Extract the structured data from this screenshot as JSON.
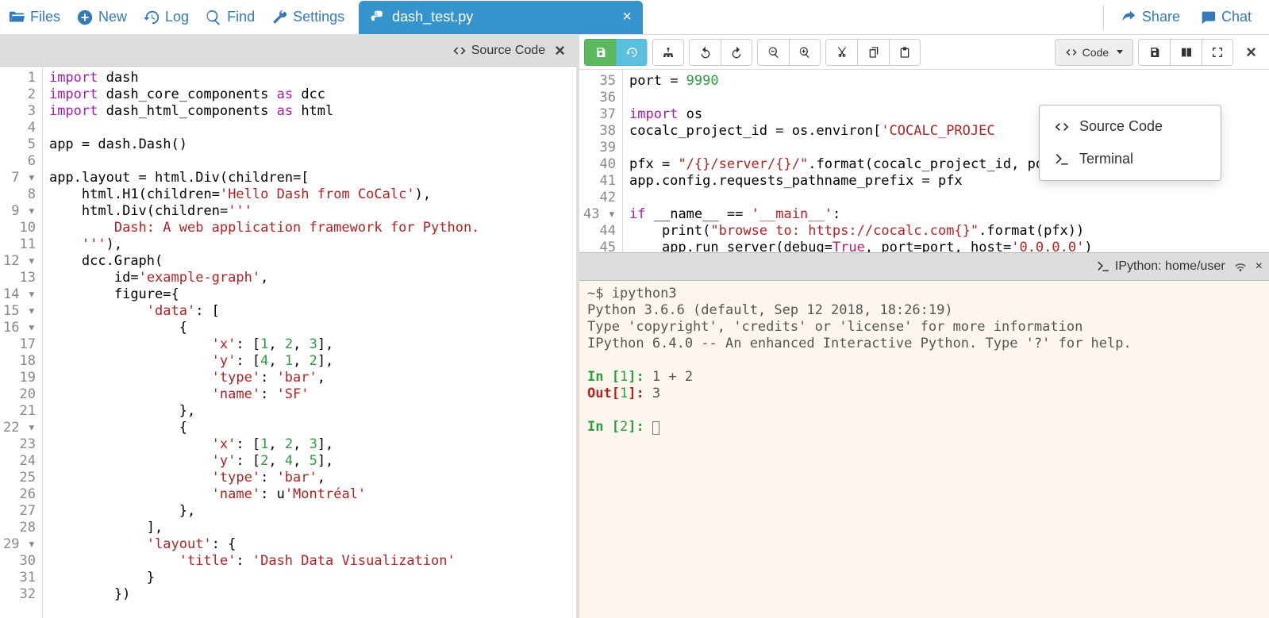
{
  "toolbar": {
    "files": "Files",
    "new": "New",
    "log": "Log",
    "find": "Find",
    "settings": "Settings",
    "share": "Share",
    "chat": "Chat"
  },
  "tab": {
    "filename": "dash_test.py"
  },
  "left_pane": {
    "title": "Source Code",
    "gutter": [
      "1",
      "2",
      "3",
      "4",
      "5",
      "6",
      "7 ▾",
      "8",
      "9 ▾",
      "10",
      "11",
      "12 ▾",
      "13",
      "14 ▾",
      "15 ▾",
      "16 ▾",
      "17",
      "18",
      "19",
      "20",
      "21",
      "22 ▾",
      "23",
      "24",
      "25",
      "26",
      "27",
      "28",
      "29 ▾",
      "30",
      "31",
      "32"
    ],
    "code_lines": [
      [
        [
          "kw",
          "import"
        ],
        [
          "pu",
          " "
        ],
        [
          "id",
          "dash"
        ]
      ],
      [
        [
          "kw",
          "import"
        ],
        [
          "pu",
          " "
        ],
        [
          "id",
          "dash_core_components"
        ],
        [
          "pu",
          " "
        ],
        [
          "kw",
          "as"
        ],
        [
          "pu",
          " "
        ],
        [
          "id",
          "dcc"
        ]
      ],
      [
        [
          "kw",
          "import"
        ],
        [
          "pu",
          " "
        ],
        [
          "id",
          "dash_html_components"
        ],
        [
          "pu",
          " "
        ],
        [
          "kw",
          "as"
        ],
        [
          "pu",
          " "
        ],
        [
          "id",
          "html"
        ]
      ],
      [],
      [
        [
          "id",
          "app "
        ],
        [
          "pu",
          "= "
        ],
        [
          "id",
          "dash.Dash()"
        ]
      ],
      [],
      [
        [
          "id",
          "app.layout "
        ],
        [
          "pu",
          "= "
        ],
        [
          "id",
          "html.Div"
        ],
        [
          "pu",
          "("
        ],
        [
          "id",
          "children"
        ],
        [
          "pu",
          "=["
        ]
      ],
      [
        [
          "pu",
          "    "
        ],
        [
          "id",
          "html.H1"
        ],
        [
          "pu",
          "("
        ],
        [
          "id",
          "children"
        ],
        [
          "pu",
          "="
        ],
        [
          "str",
          "'Hello Dash from CoCalc'"
        ],
        [
          "pu",
          "),"
        ]
      ],
      [
        [
          "pu",
          "    "
        ],
        [
          "id",
          "html.Div"
        ],
        [
          "pu",
          "("
        ],
        [
          "id",
          "children"
        ],
        [
          "pu",
          "="
        ],
        [
          "str",
          "'''"
        ]
      ],
      [
        [
          "pu",
          "        "
        ],
        [
          "str",
          "Dash: A web application framework for Python."
        ]
      ],
      [
        [
          "pu",
          "    "
        ],
        [
          "str",
          "'''"
        ],
        [
          "pu",
          "),"
        ]
      ],
      [
        [
          "pu",
          "    "
        ],
        [
          "id",
          "dcc.Graph"
        ],
        [
          "pu",
          "("
        ]
      ],
      [
        [
          "pu",
          "        "
        ],
        [
          "id",
          "id"
        ],
        [
          "pu",
          "="
        ],
        [
          "str",
          "'example-graph'"
        ],
        [
          "pu",
          ","
        ]
      ],
      [
        [
          "pu",
          "        "
        ],
        [
          "id",
          "figure"
        ],
        [
          "pu",
          "={"
        ]
      ],
      [
        [
          "pu",
          "            "
        ],
        [
          "str",
          "'data'"
        ],
        [
          "pu",
          ": ["
        ]
      ],
      [
        [
          "pu",
          "                {"
        ]
      ],
      [
        [
          "pu",
          "                    "
        ],
        [
          "str",
          "'x'"
        ],
        [
          "pu",
          ": ["
        ],
        [
          "num",
          "1"
        ],
        [
          "pu",
          ", "
        ],
        [
          "num",
          "2"
        ],
        [
          "pu",
          ", "
        ],
        [
          "num",
          "3"
        ],
        [
          "pu",
          "],"
        ]
      ],
      [
        [
          "pu",
          "                    "
        ],
        [
          "str",
          "'y'"
        ],
        [
          "pu",
          ": ["
        ],
        [
          "num",
          "4"
        ],
        [
          "pu",
          ", "
        ],
        [
          "num",
          "1"
        ],
        [
          "pu",
          ", "
        ],
        [
          "num",
          "2"
        ],
        [
          "pu",
          "],"
        ]
      ],
      [
        [
          "pu",
          "                    "
        ],
        [
          "str",
          "'type'"
        ],
        [
          "pu",
          ": "
        ],
        [
          "str",
          "'bar'"
        ],
        [
          "pu",
          ","
        ]
      ],
      [
        [
          "pu",
          "                    "
        ],
        [
          "str",
          "'name'"
        ],
        [
          "pu",
          ": "
        ],
        [
          "str",
          "'SF'"
        ]
      ],
      [
        [
          "pu",
          "                },"
        ]
      ],
      [
        [
          "pu",
          "                {"
        ]
      ],
      [
        [
          "pu",
          "                    "
        ],
        [
          "str",
          "'x'"
        ],
        [
          "pu",
          ": ["
        ],
        [
          "num",
          "1"
        ],
        [
          "pu",
          ", "
        ],
        [
          "num",
          "2"
        ],
        [
          "pu",
          ", "
        ],
        [
          "num",
          "3"
        ],
        [
          "pu",
          "],"
        ]
      ],
      [
        [
          "pu",
          "                    "
        ],
        [
          "str",
          "'y'"
        ],
        [
          "pu",
          ": ["
        ],
        [
          "num",
          "2"
        ],
        [
          "pu",
          ", "
        ],
        [
          "num",
          "4"
        ],
        [
          "pu",
          ", "
        ],
        [
          "num",
          "5"
        ],
        [
          "pu",
          "],"
        ]
      ],
      [
        [
          "pu",
          "                    "
        ],
        [
          "str",
          "'type'"
        ],
        [
          "pu",
          ": "
        ],
        [
          "str",
          "'bar'"
        ],
        [
          "pu",
          ","
        ]
      ],
      [
        [
          "pu",
          "                    "
        ],
        [
          "str",
          "'name'"
        ],
        [
          "pu",
          ": "
        ],
        [
          "id",
          "u"
        ],
        [
          "str",
          "'Montréal'"
        ]
      ],
      [
        [
          "pu",
          "                },"
        ]
      ],
      [
        [
          "pu",
          "            ],"
        ]
      ],
      [
        [
          "pu",
          "            "
        ],
        [
          "str",
          "'layout'"
        ],
        [
          "pu",
          ": {"
        ]
      ],
      [
        [
          "pu",
          "                "
        ],
        [
          "str",
          "'title'"
        ],
        [
          "pu",
          ": "
        ],
        [
          "str",
          "'Dash Data Visualization'"
        ]
      ],
      [
        [
          "pu",
          "            }"
        ]
      ],
      [
        [
          "pu",
          "        })"
        ]
      ]
    ]
  },
  "right_toolbar": {
    "code_label": "Code"
  },
  "right_editor": {
    "gutter": [
      "35",
      "36",
      "37",
      "38",
      "39",
      "40",
      "41",
      "42",
      "43 ▾",
      "44",
      "45"
    ],
    "code_lines": [
      [
        [
          "id",
          "port "
        ],
        [
          "pu",
          "= "
        ],
        [
          "num",
          "9990"
        ]
      ],
      [],
      [
        [
          "kw",
          "import"
        ],
        [
          "pu",
          " "
        ],
        [
          "id",
          "os"
        ]
      ],
      [
        [
          "id",
          "cocalc_project_id "
        ],
        [
          "pu",
          "= "
        ],
        [
          "id",
          "os.environ["
        ],
        [
          "str",
          "'COCALC_PROJEC"
        ]
      ],
      [],
      [
        [
          "id",
          "pfx "
        ],
        [
          "pu",
          "= "
        ],
        [
          "str",
          "\"/{}/server/{}/\""
        ],
        [
          "pu",
          "."
        ],
        [
          "id",
          "format"
        ],
        [
          "pu",
          "("
        ],
        [
          "id",
          "cocalc_project_id"
        ],
        [
          "pu",
          ", "
        ],
        [
          "id",
          "port"
        ],
        [
          "pu",
          ")"
        ]
      ],
      [
        [
          "id",
          "app.config.requests_pathname_prefix "
        ],
        [
          "pu",
          "= "
        ],
        [
          "id",
          "pfx"
        ]
      ],
      [],
      [
        [
          "kw",
          "if"
        ],
        [
          "pu",
          " "
        ],
        [
          "id",
          "__name__"
        ],
        [
          "pu",
          " == "
        ],
        [
          "str",
          "'__main__'"
        ],
        [
          "pu",
          ":"
        ]
      ],
      [
        [
          "pu",
          "    "
        ],
        [
          "id",
          "print"
        ],
        [
          "pu",
          "("
        ],
        [
          "str",
          "\"browse to: https://cocalc.com{}\""
        ],
        [
          "pu",
          "."
        ],
        [
          "id",
          "format"
        ],
        [
          "pu",
          "("
        ],
        [
          "id",
          "pfx"
        ],
        [
          "pu",
          "))"
        ]
      ],
      [
        [
          "pu",
          "    "
        ],
        [
          "id",
          "app.run_server"
        ],
        [
          "pu",
          "("
        ],
        [
          "id",
          "debug"
        ],
        [
          "pu",
          "="
        ],
        [
          "bool",
          "True"
        ],
        [
          "pu",
          ", "
        ],
        [
          "id",
          "port"
        ],
        [
          "pu",
          "="
        ],
        [
          "id",
          "port"
        ],
        [
          "pu",
          ", "
        ],
        [
          "id",
          "host"
        ],
        [
          "pu",
          "="
        ],
        [
          "str",
          "'0.0.0.0'"
        ],
        [
          "pu",
          ")"
        ]
      ]
    ]
  },
  "dropdown": {
    "source_code": "Source Code",
    "terminal": "Terminal"
  },
  "terminal_pane": {
    "title": "IPython: home/user",
    "lines": [
      "~$ ipython3",
      "Python 3.6.6 (default, Sep 12 2018, 18:26:19)",
      "Type 'copyright', 'credits' or 'license' for more information",
      "IPython 6.4.0 -- An enhanced Interactive Python. Type '?' for help.",
      "",
      "__IN1__",
      "__OUT1__",
      "",
      "__IN2__"
    ],
    "in1_expr": "1 + 2",
    "out1_val": "3"
  }
}
